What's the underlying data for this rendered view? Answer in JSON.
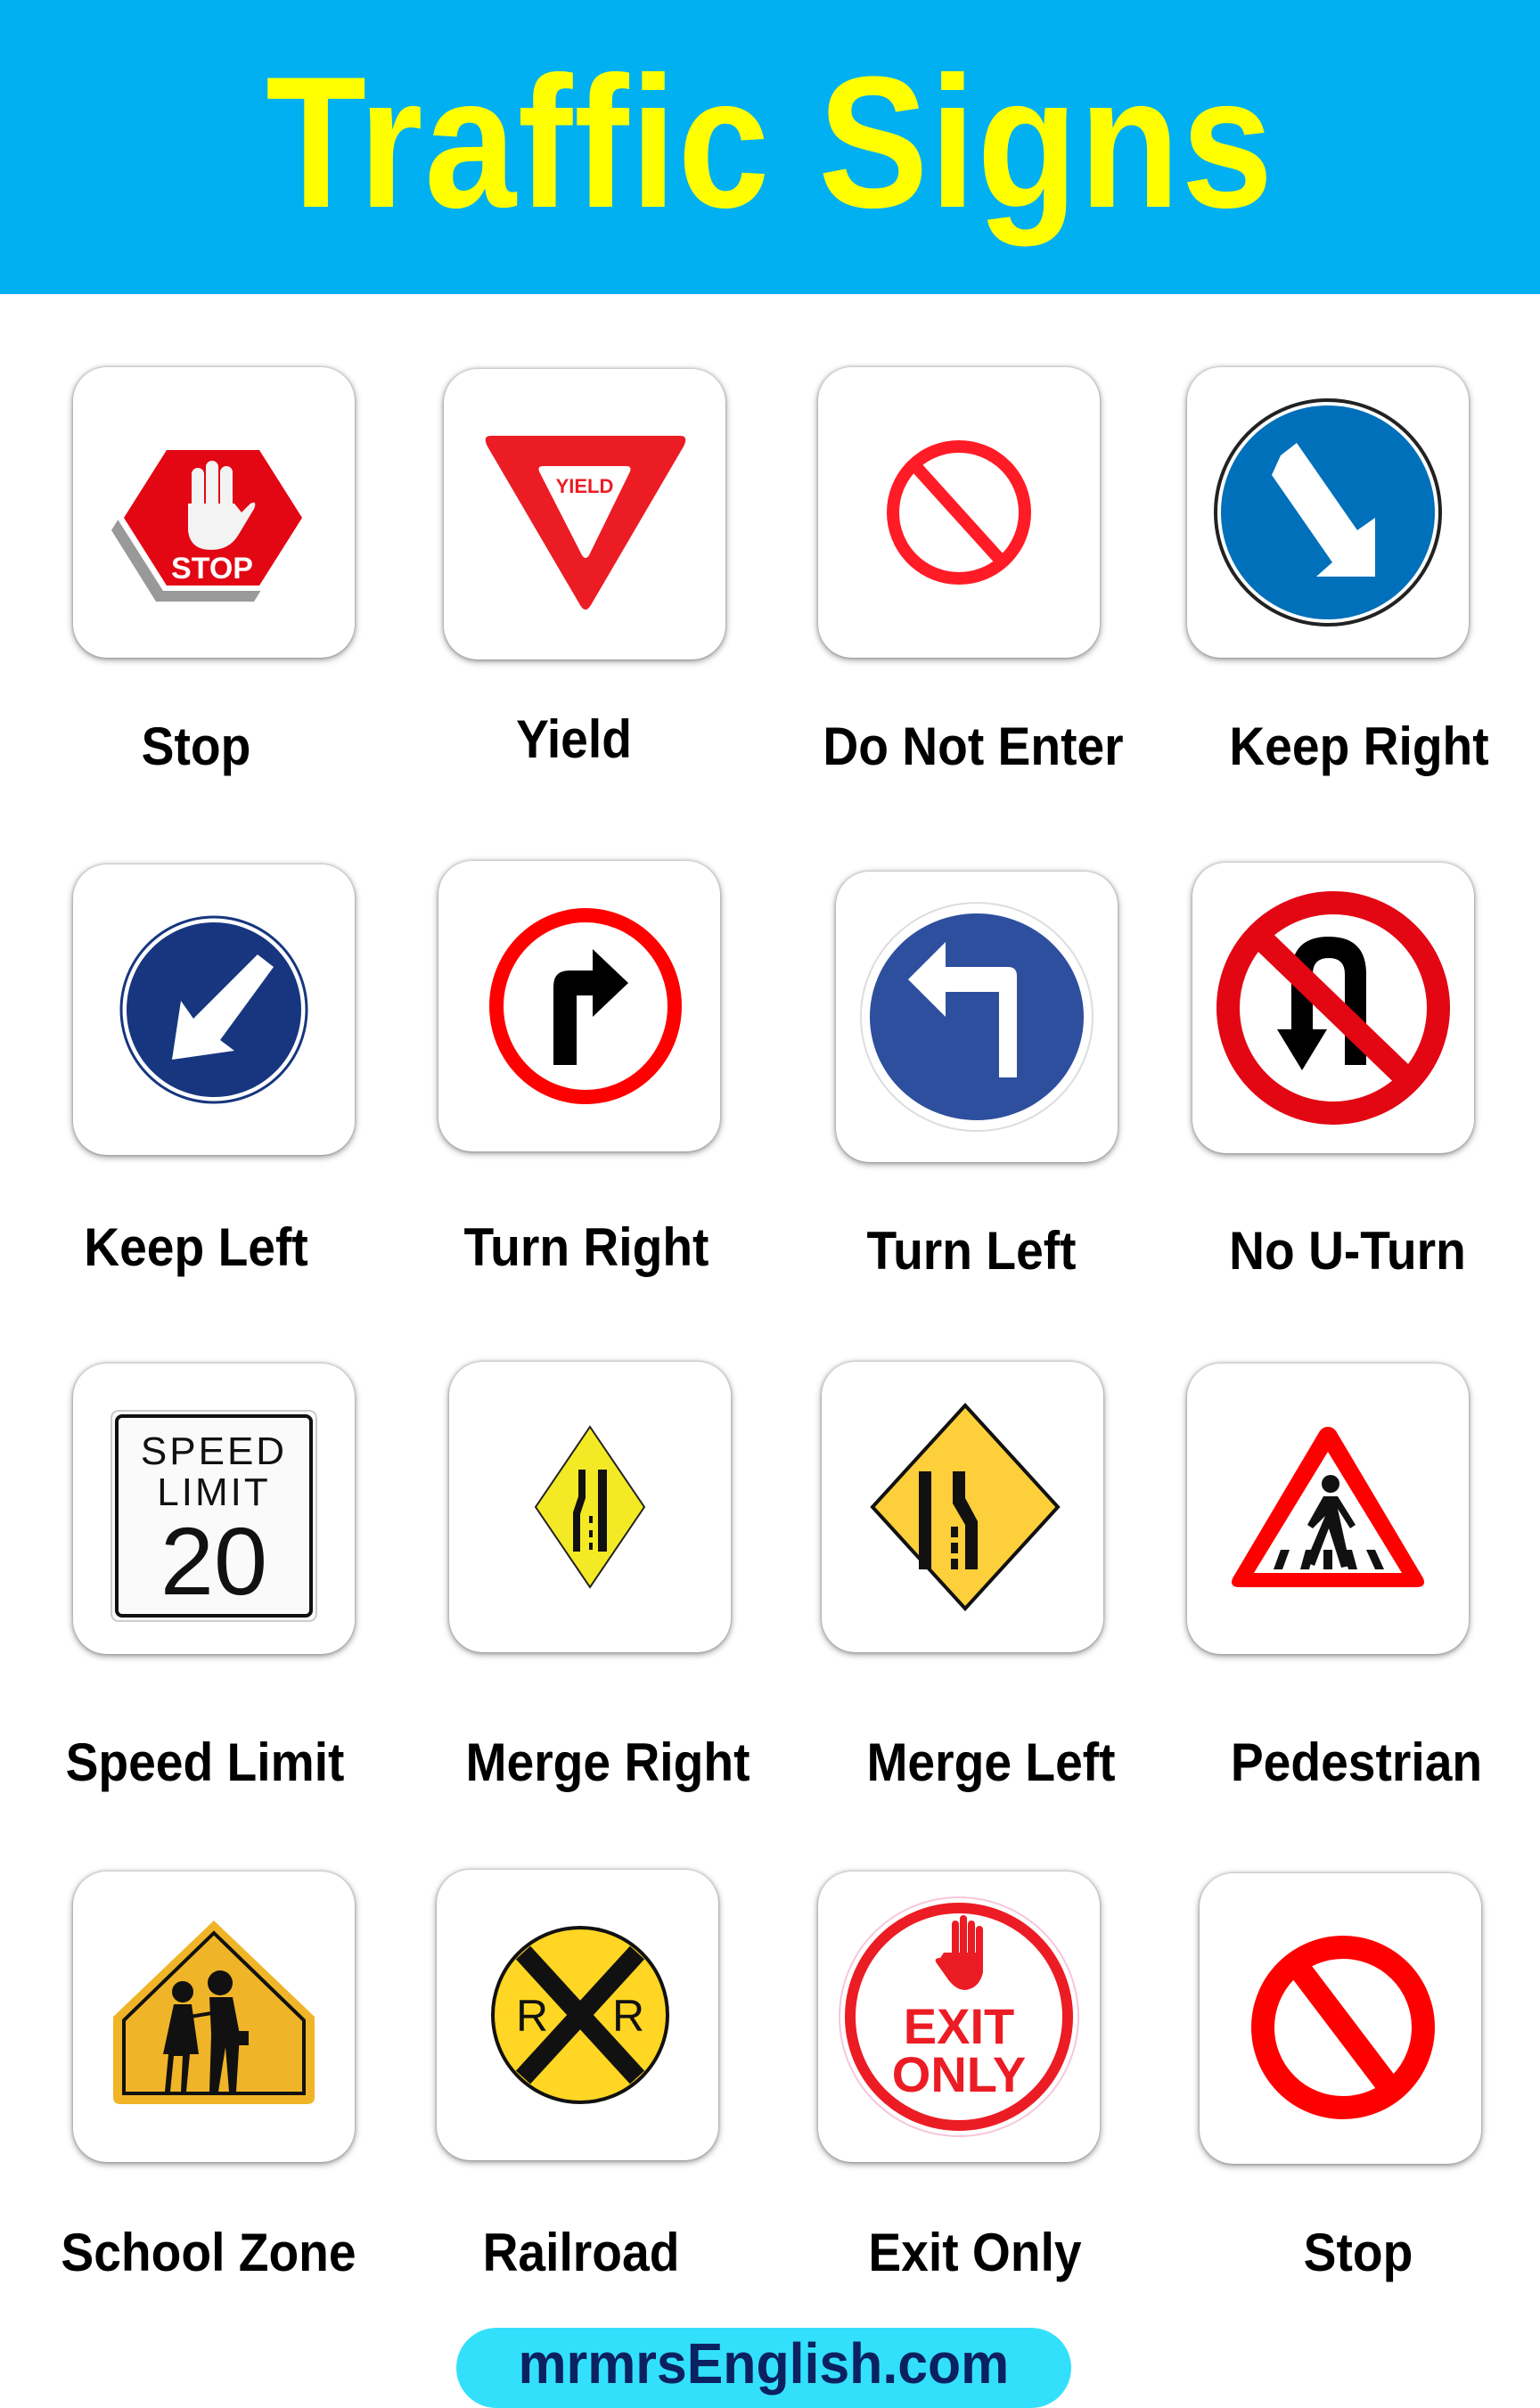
{
  "header": {
    "title": "Traffic Signs"
  },
  "colors": {
    "header_bg": "#00b0f0",
    "title": "#ffff00",
    "footer_bg": "#33e0fb",
    "footer_text": "#0b2160",
    "sign_red": "#e30613",
    "sign_blue": "#0070c0",
    "sign_yellow": "#fcd116"
  },
  "signs": [
    {
      "label": "Stop",
      "icon": "stop-hand-octagon-icon",
      "sign_text": "STOP"
    },
    {
      "label": "Yield",
      "icon": "yield-triangle-icon",
      "sign_text": "YIELD"
    },
    {
      "label": "Do Not Enter",
      "icon": "prohibition-circle-icon"
    },
    {
      "label": "Keep Right",
      "icon": "keep-right-arrow-icon"
    },
    {
      "label": "Keep Left",
      "icon": "keep-left-arrow-icon"
    },
    {
      "label": "Turn Right",
      "icon": "turn-right-arrow-icon"
    },
    {
      "label": "Turn Left",
      "icon": "turn-left-arrow-icon"
    },
    {
      "label": "No U-Turn",
      "icon": "no-u-turn-icon"
    },
    {
      "label": "Speed Limit",
      "icon": "speed-limit-sign-icon",
      "sign_text_line1": "SPEED",
      "sign_text_line2": "LIMIT",
      "sign_value": "20"
    },
    {
      "label": "Merge Right",
      "icon": "merge-right-diamond-icon"
    },
    {
      "label": "Merge Left",
      "icon": "merge-left-diamond-icon"
    },
    {
      "label": "Pedestrian",
      "icon": "pedestrian-crossing-icon"
    },
    {
      "label": "School Zone",
      "icon": "school-zone-pentagon-icon"
    },
    {
      "label": "Railroad",
      "icon": "railroad-crossing-icon",
      "sign_text_left": "R",
      "sign_text_right": "R"
    },
    {
      "label": "Exit Only",
      "icon": "exit-only-hand-icon",
      "sign_text_line1": "EXIT",
      "sign_text_line2": "ONLY"
    },
    {
      "label": "Stop",
      "icon": "prohibition-circle-icon"
    }
  ],
  "footer": {
    "text": "mrmrsEnglish.com"
  }
}
